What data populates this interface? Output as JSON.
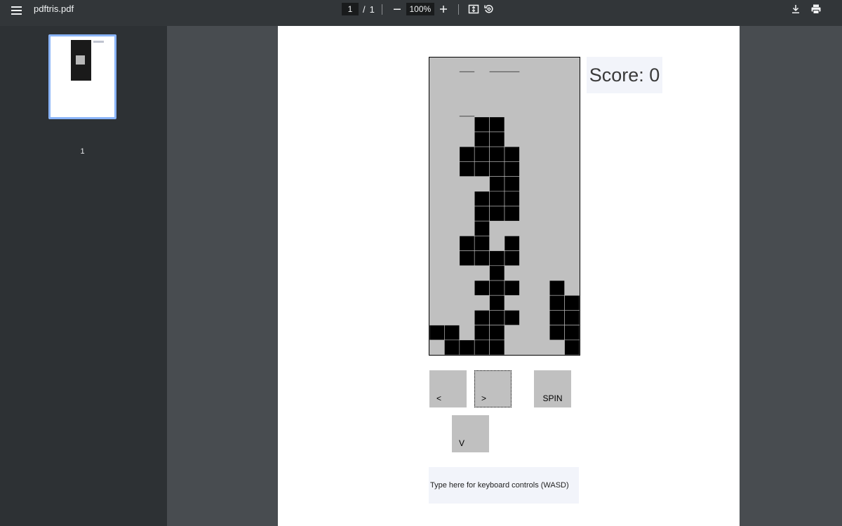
{
  "toolbar": {
    "filename": "pdftris.pdf",
    "current_page": "1",
    "page_separator": "/",
    "total_pages": "1",
    "zoom": "100%",
    "zoom_out_icon": "minus-icon",
    "zoom_in_icon": "plus-icon",
    "fit_icon": "fit-page-icon",
    "rotate_icon": "rotate-icon",
    "download_icon": "download-icon",
    "print_icon": "print-icon"
  },
  "sidebar": {
    "thumbnails": [
      {
        "label": "1"
      }
    ]
  },
  "game": {
    "score_text": "Score: 0",
    "colors": {
      "board": "#c0c0c0",
      "block": "#000000",
      "button": "#c0c0c0"
    },
    "board_grid": {
      "cols": 10,
      "rows": 20,
      "filled": [
        [
          3,
          4
        ],
        [
          4,
          4
        ],
        [
          3,
          5
        ],
        [
          4,
          5
        ],
        [
          2,
          6
        ],
        [
          3,
          6
        ],
        [
          4,
          6
        ],
        [
          5,
          6
        ],
        [
          2,
          7
        ],
        [
          3,
          7
        ],
        [
          4,
          7
        ],
        [
          5,
          7
        ],
        [
          4,
          8
        ],
        [
          5,
          8
        ],
        [
          3,
          9
        ],
        [
          4,
          9
        ],
        [
          5,
          9
        ],
        [
          3,
          10
        ],
        [
          4,
          10
        ],
        [
          5,
          10
        ],
        [
          3,
          11
        ],
        [
          2,
          12
        ],
        [
          3,
          12
        ],
        [
          5,
          12
        ],
        [
          2,
          13
        ],
        [
          3,
          13
        ],
        [
          4,
          13
        ],
        [
          5,
          13
        ],
        [
          4,
          14
        ],
        [
          3,
          15
        ],
        [
          4,
          15
        ],
        [
          5,
          15
        ],
        [
          8,
          15
        ],
        [
          4,
          16
        ],
        [
          8,
          16
        ],
        [
          9,
          16
        ],
        [
          3,
          17
        ],
        [
          4,
          17
        ],
        [
          5,
          17
        ],
        [
          8,
          17
        ],
        [
          9,
          17
        ],
        [
          0,
          18
        ],
        [
          1,
          18
        ],
        [
          3,
          18
        ],
        [
          4,
          18
        ],
        [
          8,
          18
        ],
        [
          9,
          18
        ],
        [
          1,
          19
        ],
        [
          2,
          19
        ],
        [
          3,
          19
        ],
        [
          4,
          19
        ],
        [
          9,
          19
        ]
      ],
      "ghost_lines": [
        [
          2,
          0,
          1
        ],
        [
          4,
          0,
          2
        ],
        [
          2,
          3,
          1
        ]
      ]
    },
    "buttons": {
      "left": "<",
      "right": ">",
      "spin": "SPIN",
      "down": "V"
    },
    "keyboard_field": "Type here for keyboard controls (WASD)"
  }
}
